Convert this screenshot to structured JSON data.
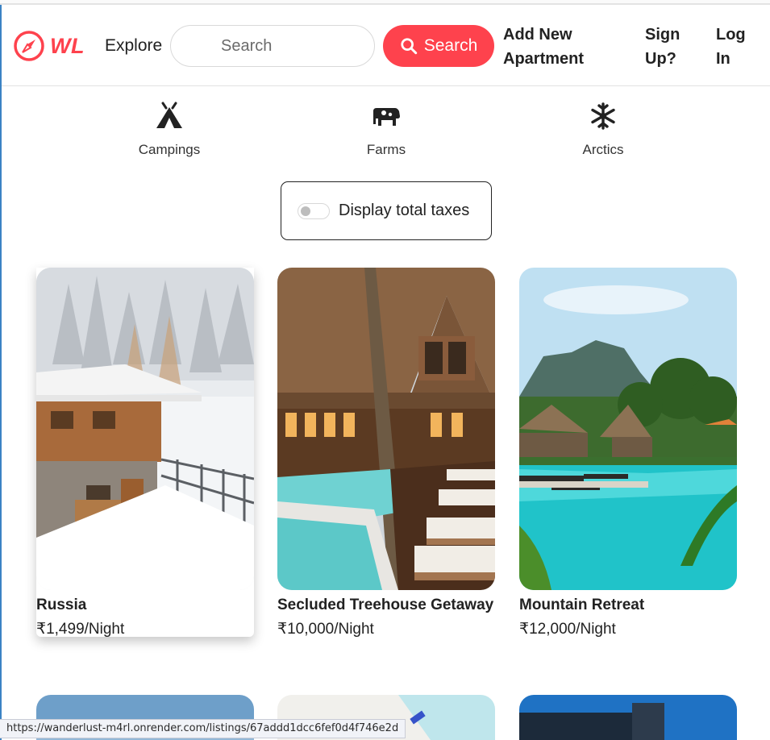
{
  "brand": {
    "logo_text": "WL",
    "accent": "#fe424d"
  },
  "nav": {
    "explore": "Explore",
    "search_placeholder": "Search",
    "search_button": "Search",
    "add_apartment": "Add New Apartment",
    "sign_up": "Sign Up?",
    "log_in": "Log In"
  },
  "filters": [
    {
      "label": "Campings",
      "icon": "tent-icon"
    },
    {
      "label": "Farms",
      "icon": "cow-icon"
    },
    {
      "label": "Arctics",
      "icon": "snowflake-icon"
    }
  ],
  "tax_toggle": {
    "label": "Display total taxes",
    "checked": false
  },
  "listings": [
    {
      "title": "Russia",
      "price": "₹1,499/Night"
    },
    {
      "title": "Secluded Treehouse Getaway",
      "price": "₹10,000/Night"
    },
    {
      "title": "Mountain Retreat",
      "price": "₹12,000/Night"
    }
  ],
  "status_bar": {
    "url": "https://wanderlust-m4rl.onrender.com/listings/67addd1dcc6fef0d4f746e2d"
  }
}
